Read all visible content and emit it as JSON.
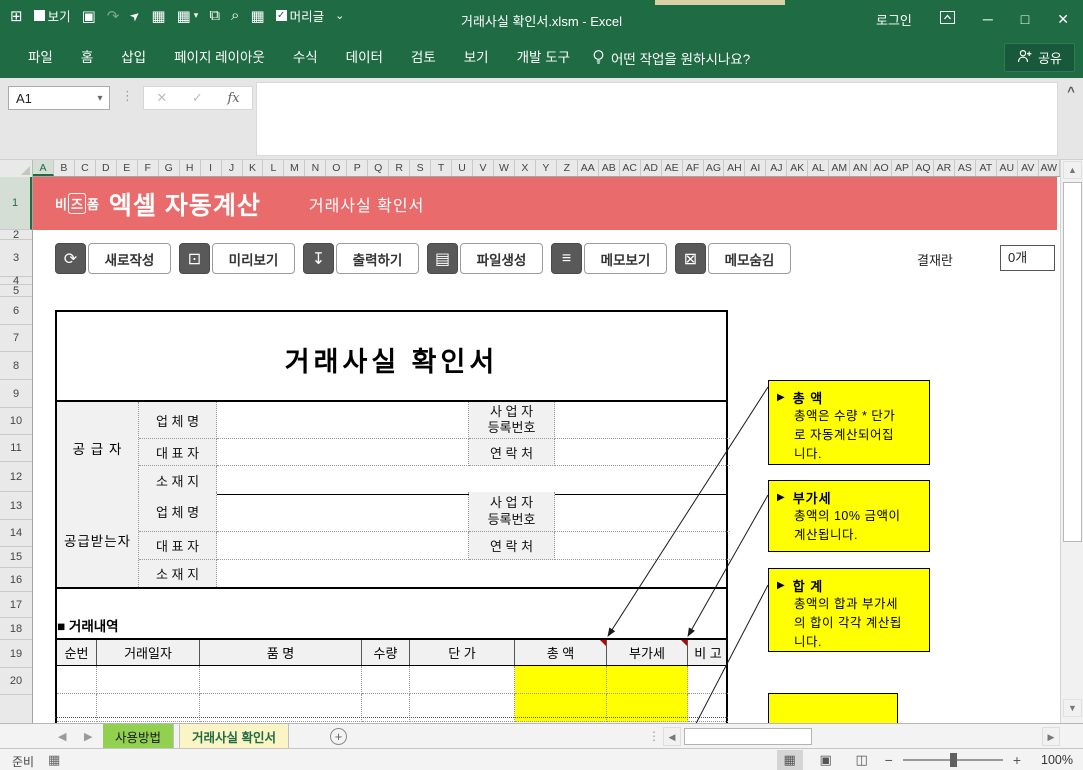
{
  "colors": {
    "excel_green": "#1F6B44",
    "banner_red": "#E96B6B",
    "note_yellow": "#FFFF00",
    "tab_green": "#92D050",
    "active_tab_cream": "#FBF5C6",
    "comment_red": "#C00000"
  },
  "window": {
    "title": "거래사실 확인서.xlsm - Excel",
    "login": "로그인",
    "controls": {
      "minimize": "─",
      "maximize": "□",
      "close": "✕"
    },
    "qat": {
      "boundaries_glyph": "⊞",
      "view_label": "보기",
      "save_glyph": "▣",
      "redo_glyph": "↷",
      "cursor_glyph": "➤",
      "table_glyph": "▦",
      "table_menu_glyph": "▦",
      "menu_arrow": "▾",
      "paste_glyph": "⧉",
      "preview_glyph": "⌕",
      "protect_glyph": "▦",
      "check_glyph": "✓",
      "header_label": "머리글",
      "more_glyph": "⌄"
    }
  },
  "ribbon": {
    "tabs": [
      "파일",
      "홈",
      "삽입",
      "페이지 레이아웃",
      "수식",
      "데이터",
      "검토",
      "보기",
      "개발 도구"
    ],
    "tell_me": "어떤 작업을 원하시나요?",
    "share_label": "공유"
  },
  "formula_bar": {
    "name_box": "A1",
    "cancel": "✕",
    "enter": "✓",
    "fx": "fx",
    "collapse": "^"
  },
  "grid": {
    "columns": [
      "A",
      "B",
      "C",
      "D",
      "E",
      "F",
      "G",
      "H",
      "I",
      "J",
      "K",
      "L",
      "M",
      "N",
      "O",
      "P",
      "Q",
      "R",
      "S",
      "T",
      "U",
      "V",
      "W",
      "X",
      "Y",
      "Z",
      "AA",
      "AB",
      "AC",
      "AD",
      "AE",
      "AF",
      "AG",
      "AH",
      "AI",
      "AJ",
      "AK",
      "AL",
      "AM",
      "AN",
      "AO",
      "AP",
      "AQ",
      "AR",
      "AS",
      "AT",
      "AU",
      "AV",
      "AW"
    ],
    "rows": [
      "1",
      "2",
      "3",
      "4",
      "5",
      "6",
      "7",
      "8",
      "9",
      "10",
      "11",
      "12",
      "13",
      "14",
      "15",
      "16",
      "17",
      "18",
      "19",
      "20"
    ]
  },
  "sheet": {
    "banner": {
      "logo_part1": "비",
      "logo_boxed": "즈",
      "logo_part3": "폼",
      "logo_title": "엑셀 자동계산",
      "doc_type": "거래사실 확인서"
    },
    "action_buttons": [
      {
        "label": "새로작성",
        "icon": "refresh-clipboard-icon",
        "glyph": "⟳"
      },
      {
        "label": "미리보기",
        "icon": "monitor-preview-icon",
        "glyph": "⊡"
      },
      {
        "label": "출력하기",
        "icon": "print-document-icon",
        "glyph": "↧"
      },
      {
        "label": "파일생성",
        "icon": "folder-file-icon",
        "glyph": "▤"
      },
      {
        "label": "메모보기",
        "icon": "memo-show-icon",
        "glyph": "≡"
      },
      {
        "label": "메모숨김",
        "icon": "memo-hide-icon",
        "glyph": "⊠"
      }
    ],
    "approval": {
      "label": "결재란",
      "value": "0개"
    },
    "document": {
      "title": "거래사실 확인서",
      "info_labels": {
        "supplier": "공 급 자",
        "receiver": "공급받는자",
        "company": "업 체 명",
        "ceo": "대 표 자",
        "address": "소 재 지",
        "biz_no_line1": "사 업 자",
        "biz_no_line2": "등록번호",
        "contact": "연 락 처"
      },
      "transactions": {
        "section_title": "■ 거래내역",
        "headers": [
          "순번",
          "거래일자",
          "품  명",
          "수량",
          "단  가",
          "총  액",
          "부가세",
          "비  고"
        ]
      }
    },
    "notes": [
      {
        "arrow": "▶",
        "title": "총  액",
        "lines": [
          "총액은 수량 * 단가",
          "로 자동계산되어집",
          "니다."
        ]
      },
      {
        "arrow": "▶",
        "title": "부가세",
        "lines": [
          "총액의 10% 금액이",
          "계산됩니다."
        ]
      },
      {
        "arrow": "▶",
        "title": "합  계",
        "lines": [
          "총액의 합과 부가세",
          "의 합이 각각 계산됩",
          "니다."
        ]
      }
    ]
  },
  "tabs_bar": {
    "prev": "◀",
    "next": "▶",
    "sheet_tabs": [
      "사용방법",
      "거래사실 확인서"
    ],
    "active_tab": "거래사실 확인서",
    "add_sheet": "+",
    "dots": "⋮"
  },
  "scrollbars": {
    "up": "▲",
    "down": "▼",
    "left": "◀",
    "right": "▶"
  },
  "status_bar": {
    "ready": "준비",
    "macro_glyph": "▦",
    "views": [
      "▦",
      "▣",
      "◫"
    ],
    "zoom_out": "−",
    "zoom_in": "+",
    "zoom": "100%"
  }
}
